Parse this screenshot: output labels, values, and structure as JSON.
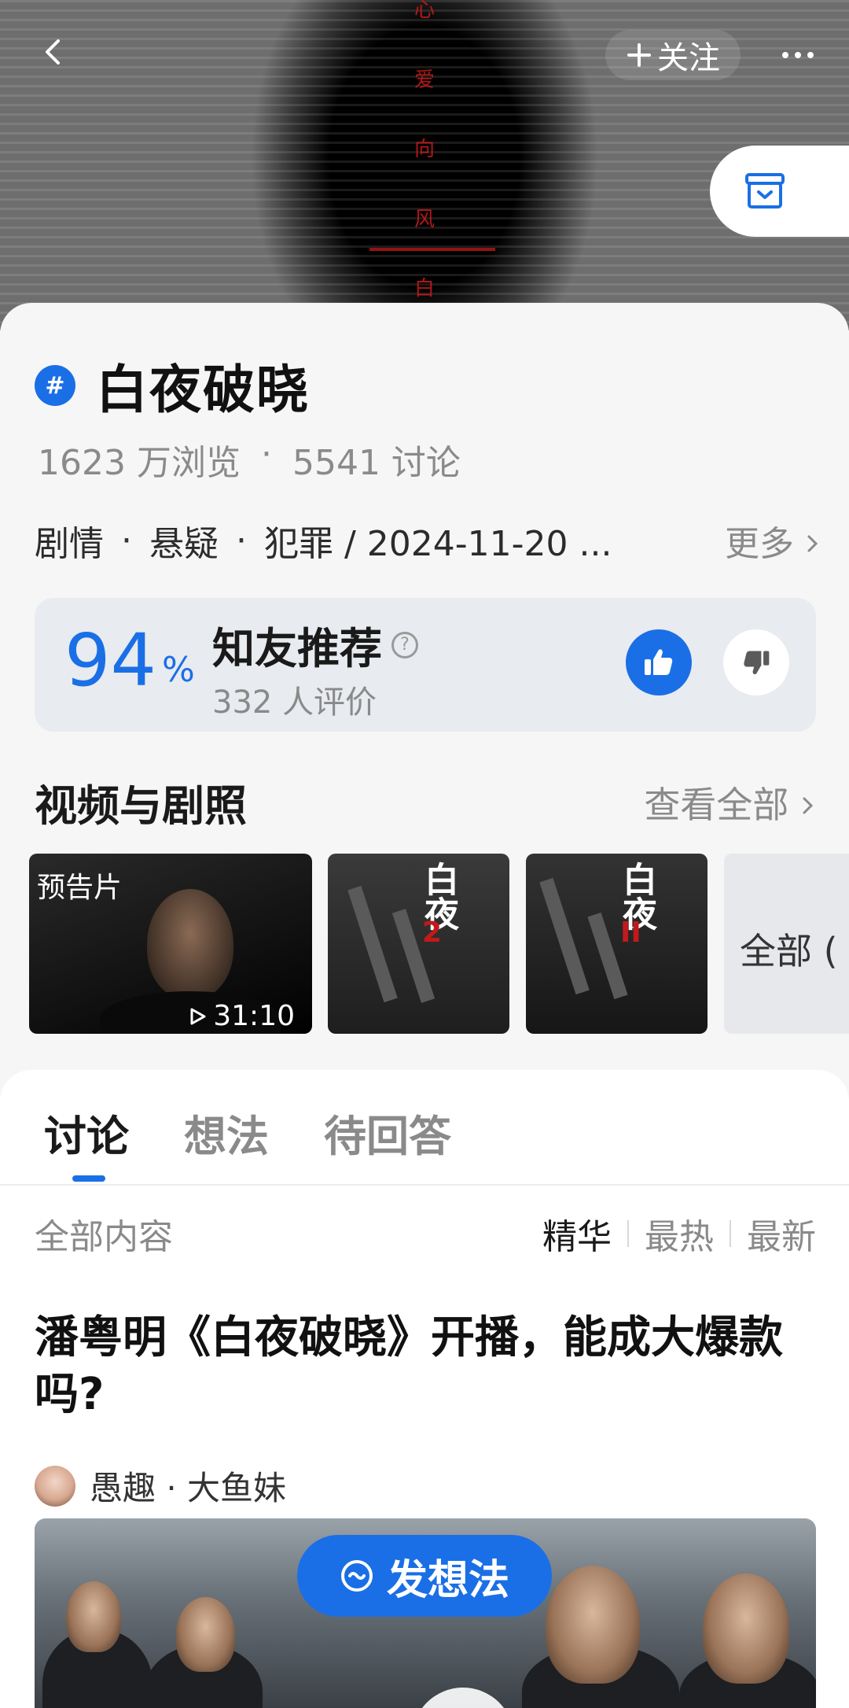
{
  "header": {
    "follow_label": "关注",
    "hero_red_chars": [
      "心",
      "爱",
      "向",
      "风",
      "白"
    ]
  },
  "topic": {
    "title": "白夜破晓",
    "views": "1623 万浏览",
    "dot": "·",
    "discussions": "5541 讨论"
  },
  "tags": {
    "items": [
      "剧情",
      "悬疑",
      "犯罪 / 2024-11-20 ..."
    ],
    "more": "更多"
  },
  "rating": {
    "percent": "94",
    "percent_sign": "%",
    "label": "知友推荐",
    "count": "332 人评价"
  },
  "media_section": {
    "title": "视频与剧照",
    "view_all": "查看全部",
    "video_tag": "预告片",
    "video_duration": "31:10",
    "more_tile": "全部 ("
  },
  "tabs": [
    "讨论",
    "想法",
    "待回答"
  ],
  "filter": {
    "label": "全部内容",
    "sorts": [
      "精华",
      "最热",
      "最新"
    ]
  },
  "post": {
    "title": "潘粤明《白夜破晓》开播，能成大爆款吗?",
    "author": "愚趣 · 大鱼妹"
  },
  "fab": {
    "label": "发想法"
  },
  "colors": {
    "accent": "#1a6fe6",
    "muted": "#8a8a8a",
    "card_bg": "#f6f6f6"
  },
  "icons": [
    "back-arrow-icon",
    "plus-icon",
    "more-dots-icon",
    "save-box-icon",
    "topic-hash-icon",
    "help-icon",
    "thumb-up-icon",
    "thumb-down-icon",
    "chevron-right-icon",
    "play-triangle-icon",
    "idea-icon"
  ]
}
